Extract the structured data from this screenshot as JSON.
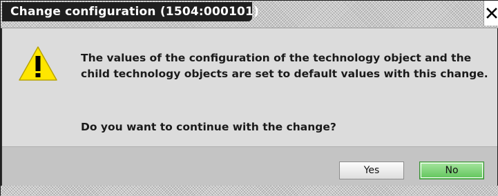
{
  "dialog": {
    "title": "Change configuration (1504:000101)",
    "close_icon": "close-icon",
    "warning_icon": "warning-icon",
    "message": "The values of the configuration of the technology object  and the child technology objects are set to default values with this change.",
    "question": "Do you want to continue with the change?",
    "buttons": {
      "yes_label": "Yes",
      "no_label": "No"
    },
    "colors": {
      "title_chip": "#1f1f1f",
      "content_bg": "#dcdcdc",
      "button_bar_bg": "#c4c4c4",
      "warning_yellow": "#ffe600",
      "default_button_green": "#5fc45a"
    }
  }
}
